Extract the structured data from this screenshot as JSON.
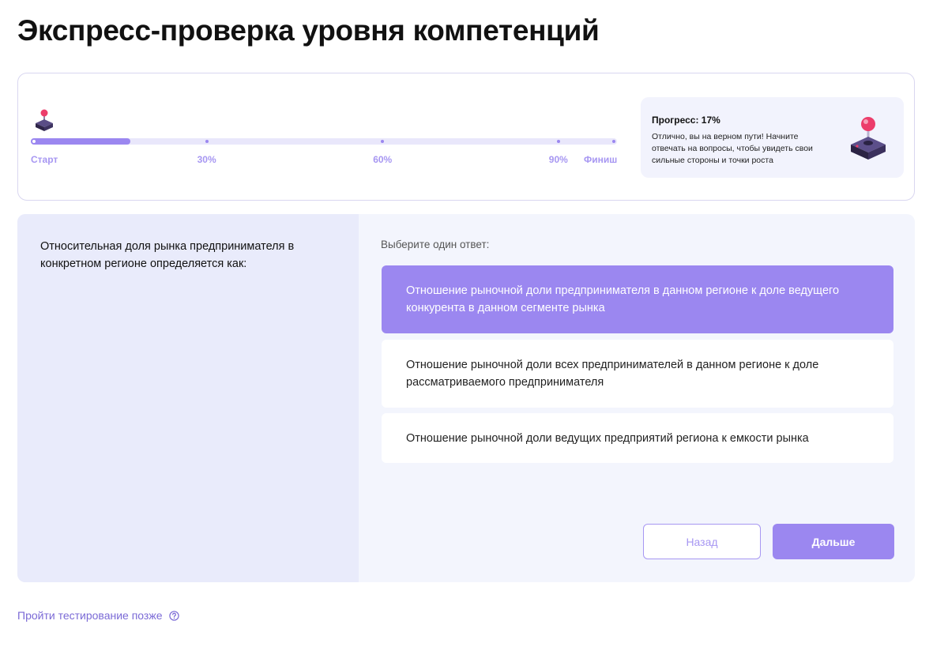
{
  "page": {
    "title": "Экспресс-проверка уровня компетенций"
  },
  "progress": {
    "percent": 17,
    "ticks": [
      {
        "label": "Старт",
        "percent": 0
      },
      {
        "label": "30%",
        "percent": 30
      },
      {
        "label": "60%",
        "percent": 60
      },
      {
        "label": "90%",
        "percent": 90
      },
      {
        "label": "Финиш",
        "percent": 100
      }
    ],
    "info_title": "Прогресс: 17%",
    "info_text": "Отлично, вы на верном пути! Начните отвечать на вопросы, чтобы увидеть свои сильные стороны и точки роста",
    "marker_icon": "joystick-icon",
    "info_icon": "joystick-icon"
  },
  "question": {
    "text": "Относительная доля рынка предпринимателя в конкретном регионе определяется как:",
    "prompt": "Выберите один ответ:",
    "options": [
      {
        "label": "Отношение рыночной доли предпринимателя в данном регионе к доле ведущего конкурента в данном сегменте рынка",
        "selected": true
      },
      {
        "label": "Отношение рыночной доли всех предпринимателей в данном регионе к доле рассматриваемого предпринимателя",
        "selected": false
      },
      {
        "label": "Отношение рыночной доли ведущих предприятий региона к емкости рынка",
        "selected": false
      }
    ]
  },
  "buttons": {
    "back_label": "Назад",
    "next_label": "Дальше"
  },
  "footer": {
    "later_label": "Пройти тестирование позже",
    "help_icon": "question-circle-icon"
  },
  "colors": {
    "accent": "#9b87f0",
    "accent_light": "#e9e7fb",
    "link": "#7b6ad6",
    "joystick_knob": "#ec3d6b",
    "joystick_base": "#3a2f5c"
  }
}
